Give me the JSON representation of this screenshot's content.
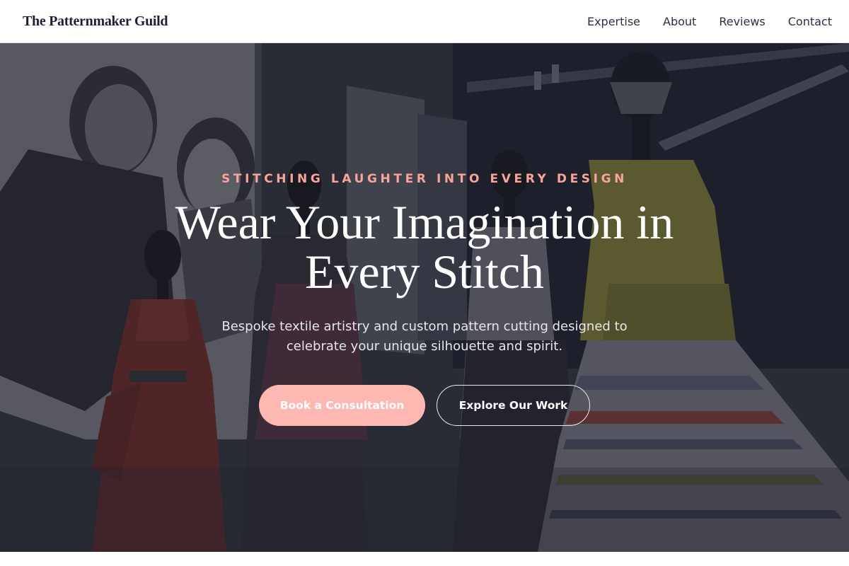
{
  "header": {
    "brand": "The Patternmaker Guild",
    "nav": [
      "Expertise",
      "About",
      "Reviews",
      "Contact"
    ]
  },
  "hero": {
    "tagline": "STITCHING LAUGHTER INTO EVERY DESIGN",
    "headline_line1": "Wear Your Imagination in",
    "headline_line2": "Every Stitch",
    "subtitle_line1": "Bespoke textile artistry and custom pattern cutting designed to",
    "subtitle_line2": "celebrate your unique silhouette and spirit.",
    "primary_cta": "Book a Consultation",
    "secondary_cta": "Explore Our Work",
    "background_image": "fashion exhibition with dress forms and mannequins"
  },
  "colors": {
    "accent": "#feb8b2",
    "tagline": "#f7a49c",
    "brand_text": "#1c2233",
    "overlay": "#1c1e28"
  }
}
